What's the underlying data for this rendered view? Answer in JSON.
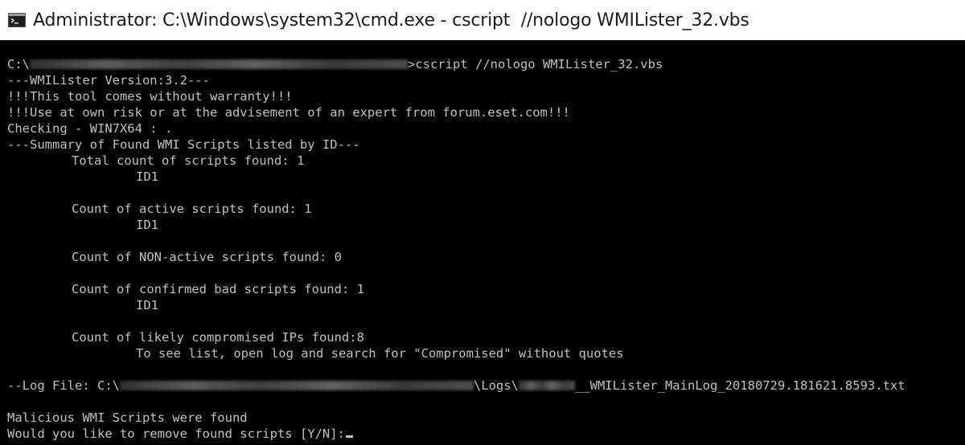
{
  "window": {
    "title": "Administrator: C:\\Windows\\system32\\cmd.exe - cscript  //nologo WMILister_32.vbs",
    "icon": "cmd-icon"
  },
  "console": {
    "prompt_prefix": "C:\\",
    "prompt_command": ">cscript //nologo WMILister_32.vbs",
    "version_line": "---WMILister Version:3.2---",
    "warranty_line": "!!!This tool comes without warranty!!!",
    "risk_line": "!!!Use at own risk or at the advisement of an expert from forum.eset.com!!!",
    "checking_line": "Checking - WIN7X64 : .",
    "summary_header": "---Summary of Found WMI Scripts listed by ID---",
    "total_label": "Total count of scripts found: 1",
    "total_id": "ID1",
    "active_label": "Count of active scripts found: 1",
    "active_id": "ID1",
    "nonactive_label": "Count of NON-active scripts found: 0",
    "bad_label": "Count of confirmed bad scripts found: 1",
    "bad_id": "ID1",
    "ips_label": "Count of likely compromised IPs found:8",
    "ips_hint": "To see list, open log and search for \"Compromised\" without quotes",
    "log_prefix": "--Log File: C:\\",
    "log_mid": "\\Logs\\",
    "log_suffix": "__WMILister_MainLog_20180729.181621.8593.txt",
    "malicious_line": "Malicious WMI Scripts were found",
    "remove_prompt": "Would you like to remove found scripts [Y/N]:"
  },
  "colors": {
    "console_bg": "#000000",
    "console_text": "#c0c0c0",
    "titlebar_bg": "#ffffff"
  }
}
